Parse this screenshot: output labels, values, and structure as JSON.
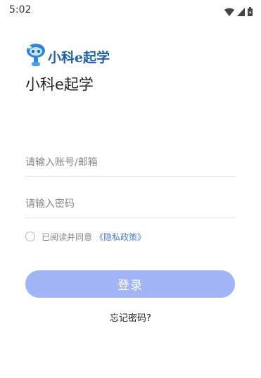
{
  "status_bar": {
    "time": "5:02",
    "icons": [
      "wifi-icon",
      "signal-icon",
      "battery-icon"
    ]
  },
  "logo": {
    "icon": "robot-mascot-icon",
    "text": "小科e起学"
  },
  "app_title": "小科e起学",
  "form": {
    "account_placeholder": "请输入账号/邮箱",
    "account_value": "",
    "password_placeholder": "请输入密码",
    "password_value": ""
  },
  "agreement": {
    "text": "已阅读并同意",
    "link": "《隐私政策》",
    "checked": false
  },
  "login_button": "登录",
  "forgot_password": "忘记密码?",
  "colors": {
    "accent": "#a1b4f5",
    "link": "#4d7be8",
    "logo": "#1f5fa6"
  }
}
